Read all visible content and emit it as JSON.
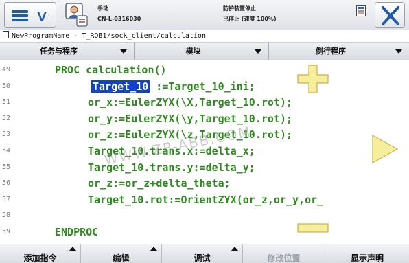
{
  "header": {
    "mode": "手动",
    "controller": "CN-L-0316030",
    "safety": "防护装置停止",
    "run_state": "已停止 (速度 100%)"
  },
  "path": "NewProgramName - T_ROB1/sock_client/calculation",
  "tabs": [
    {
      "label": "任务与程序"
    },
    {
      "label": "模块"
    },
    {
      "label": "例行程序"
    }
  ],
  "code": {
    "lines": [
      {
        "no": "49",
        "text": "PROC calculation()"
      },
      {
        "no": "50",
        "selected": "Target_10",
        "text": " :=Target_10_ini;"
      },
      {
        "no": "51",
        "text": "or_x:=EulerZYX(\\X,Target_10.rot);"
      },
      {
        "no": "52",
        "text": "or_y:=EulerZYX(\\y,Target_10.rot);"
      },
      {
        "no": "53",
        "text": "or_z:=EulerZYX(\\z,Target_10.rot);"
      },
      {
        "no": "54",
        "text": "Target_10.trans.x:=delta_x;"
      },
      {
        "no": "55",
        "text": "Target_10.trans.y:=delta_y;"
      },
      {
        "no": "56",
        "text": "or_z:=or_z+delta_theta;"
      },
      {
        "no": "57",
        "text": "Target_10.rot:=OrientZYX(or_z,or_y,or_"
      },
      {
        "no": "58",
        "text": ""
      },
      {
        "no": "59",
        "text": "ENDPROC"
      }
    ],
    "code_color": "#2e8b1e",
    "selection_color": "#1044c8"
  },
  "watermark": "WWW.ZP-ABB.COM",
  "buttons": {
    "zoom_in_icon": "plus-icon",
    "zoom_out_icon": "minus-icon",
    "next_icon": "right-arrow-icon",
    "accent": "#f6ee9a"
  },
  "bottom_tabs": [
    {
      "label": "添加指令",
      "enabled": true
    },
    {
      "label": "编辑",
      "enabled": true
    },
    {
      "label": "调试",
      "enabled": true
    },
    {
      "label": "修改位置",
      "enabled": false
    },
    {
      "label": "显示声明",
      "enabled": true
    }
  ]
}
